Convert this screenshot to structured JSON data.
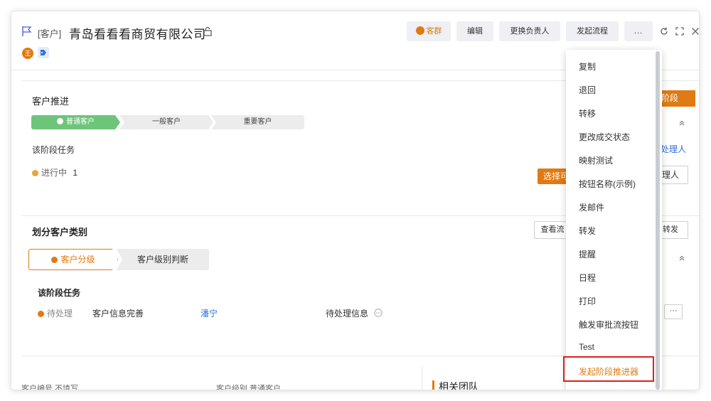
{
  "header": {
    "flag_icon": "flag-icon",
    "breadcrumb": "[客户]",
    "title": "青岛看看看商贸有限公司",
    "lock_icon": "lock-icon",
    "avatar_text": "王",
    "tag_icon": "tag-icon",
    "accent_color": "#e07a12"
  },
  "toolbar": {
    "group_label": "客群",
    "edit_label": "编辑",
    "owner_label": "更换负责人",
    "flow_label": "发起流程",
    "more_label": "...",
    "refresh_icon": "refresh-icon",
    "fullscreen_icon": "fullscreen-icon",
    "close_icon": "close-icon"
  },
  "section1": {
    "title": "客户推进",
    "steps": [
      "普通客户",
      "一般客户",
      "重要客户"
    ],
    "stage_task_title": "该阶段任务",
    "in_progress_label": "进行中",
    "in_progress_count": "1",
    "orange_tab_label": "阶段",
    "select_button_label": "选择可",
    "handler_link": "处理人",
    "handler_button": "理人"
  },
  "section2": {
    "title": "划分客户类别",
    "view_button": "查看流",
    "forward_button": "转发",
    "steps": [
      "客户分级",
      "客户级别判断"
    ],
    "stage_task_title": "该阶段任务",
    "task_status": "待处理",
    "task_name": "客户信息完善",
    "task_owner": "潘宁",
    "pending_info_label": "待处理信息",
    "row_more_label": "···"
  },
  "footer": {
    "field1": "客户编号  不填写",
    "field2": "客户级别  普通客户",
    "related_team": "相关团队"
  },
  "menu": {
    "items": [
      "复制",
      "退回",
      "转移",
      "更改成交状态",
      "映射测试",
      "按钮名称(示例)",
      "发邮件",
      "转发",
      "提醒",
      "日程",
      "打印",
      "触发审批流按钮",
      "Test",
      "发起阶段推进器"
    ],
    "highlight_color": "#e0201c"
  }
}
